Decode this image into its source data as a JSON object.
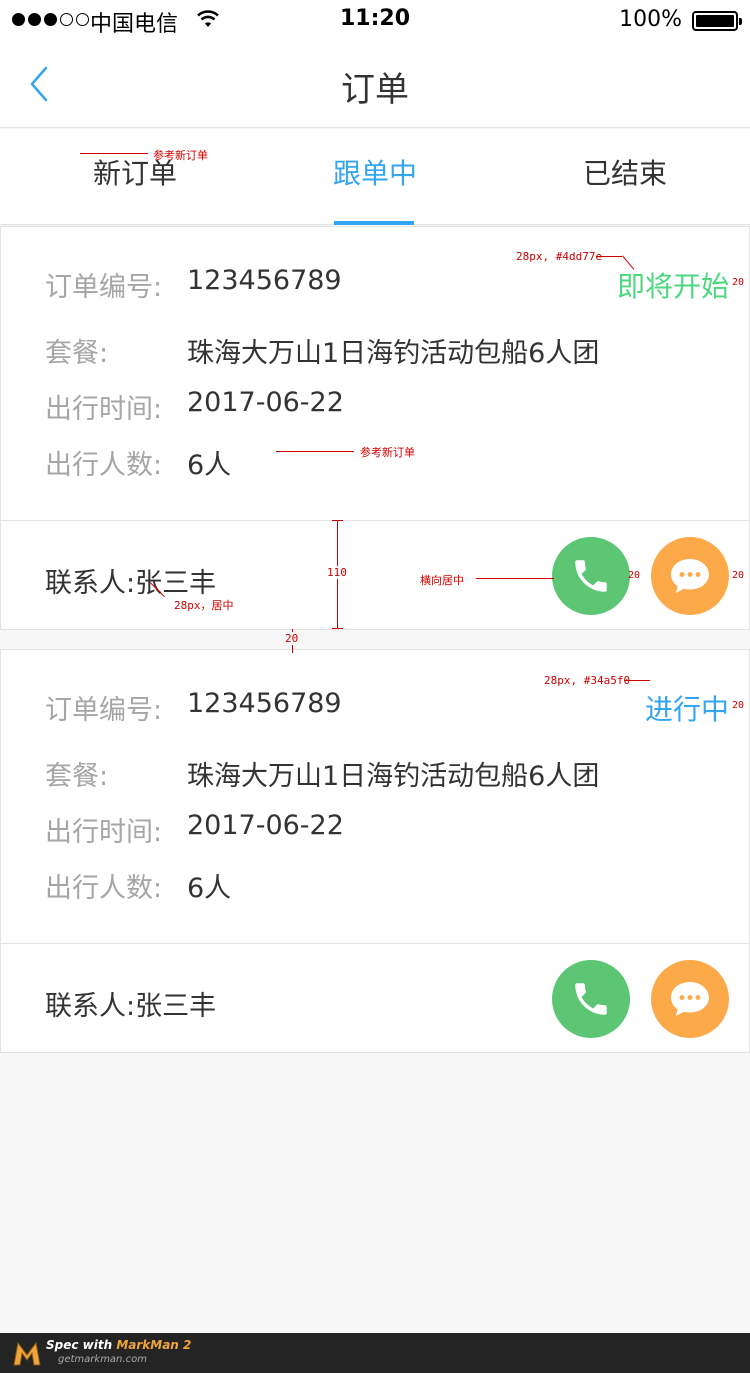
{
  "status_bar": {
    "carrier": "中国电信",
    "time": "11:20",
    "battery": "100%"
  },
  "nav": {
    "title": "订单"
  },
  "tabs": [
    {
      "label": "新订单",
      "active": false
    },
    {
      "label": "跟单中",
      "active": true
    },
    {
      "label": "已结束",
      "active": false
    }
  ],
  "colors": {
    "accent": "#34a5f0",
    "upcoming": "#4dd77e",
    "phone": "#5cc675",
    "chat": "#fca94a"
  },
  "orders": [
    {
      "order_no_label": "订单编号:",
      "order_no": "123456789",
      "status": "即将开始",
      "status_color": "#4dd77e",
      "package_label": "套餐:",
      "package": "珠海大万山1日海钓活动包船6人团",
      "date_label": "出行时间:",
      "date": "2017-06-22",
      "people_label": "出行人数:",
      "people": "6人",
      "contact": "联系人:张三丰"
    },
    {
      "order_no_label": "订单编号:",
      "order_no": "123456789",
      "status": "进行中",
      "status_color": "#34a5f0",
      "package_label": "套餐:",
      "package": "珠海大万山1日海钓活动包船6人团",
      "date_label": "出行时间:",
      "date": "2017-06-22",
      "people_label": "出行人数:",
      "people": "6人",
      "contact": "联系人:张三丰"
    }
  ],
  "annotations": {
    "ref_new_order_tab": "参考新订单",
    "status1_spec": "28px, #4dd77e",
    "ref_new_order_row": "参考新订单",
    "height_110": "110",
    "contact_spec": "28px，居中",
    "horizontal_center": "横向居中",
    "gap_20": "20",
    "status2_spec": "28px, #34a5f0",
    "margin_20": "20"
  },
  "footer": {
    "title_prefix": "Spec with ",
    "brand": "MarkMan 2",
    "url": "getmarkman.com"
  },
  "icons": [
    "back-chevron-icon",
    "wifi-icon",
    "battery-icon",
    "phone-icon",
    "chat-bubble-icon",
    "markman-logo-icon"
  ]
}
